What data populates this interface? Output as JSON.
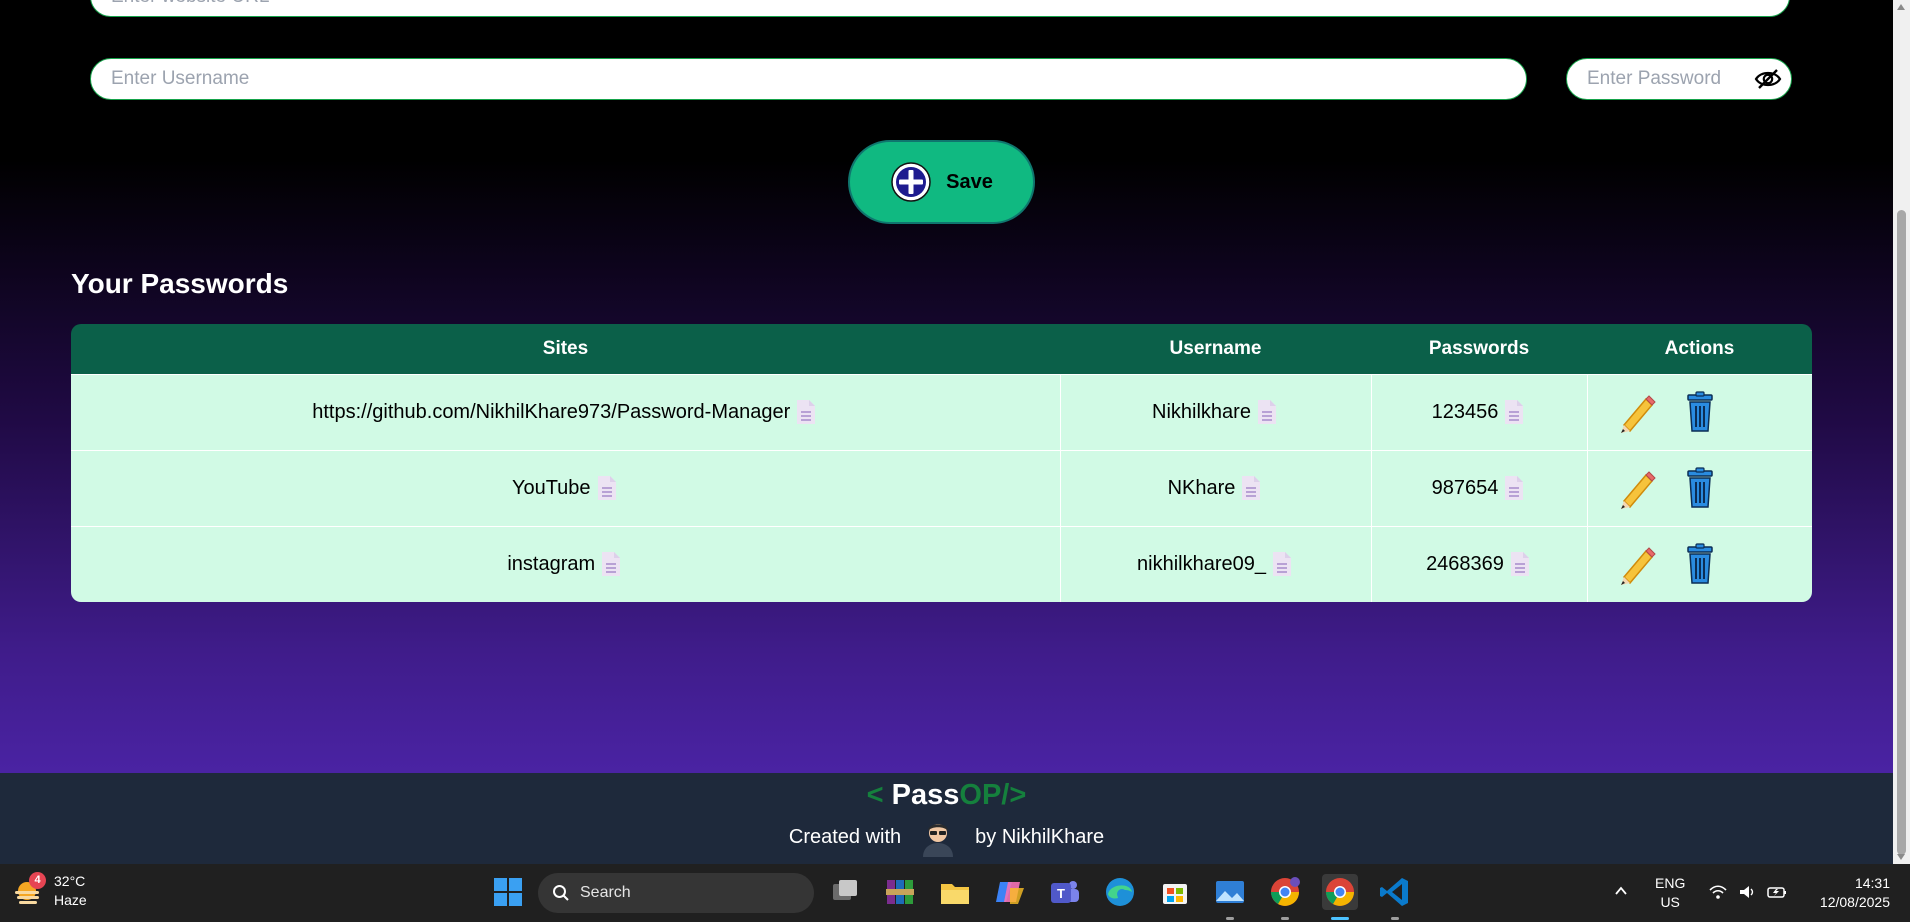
{
  "form": {
    "url_placeholder": "Enter website URL",
    "username_placeholder": "Enter Username",
    "password_placeholder": "Enter Password",
    "save_label": "Save"
  },
  "section_title": "Your Passwords",
  "table": {
    "headers": [
      "Sites",
      "Username",
      "Passwords",
      "Actions"
    ],
    "rows": [
      {
        "site": "https://github.com/NikhilKhare973/Password-Manager",
        "username": "Nikhilkhare",
        "password": "123456"
      },
      {
        "site": "YouTube",
        "username": "NKhare",
        "password": "987654"
      },
      {
        "site": "instagram",
        "username": "nikhilkhare09_",
        "password": "2468369"
      }
    ]
  },
  "footer": {
    "logo_open": "<",
    "logo_pass": "Pass",
    "logo_op": "OP/>",
    "created_with": "Created with",
    "by": "by NikhilKhare"
  },
  "taskbar": {
    "weather_badge": "4",
    "temperature": "32°C",
    "condition": "Haze",
    "search_label": "Search",
    "lang_1": "ENG",
    "lang_2": "US",
    "time": "14:31",
    "date": "12/08/2025"
  },
  "colors": {
    "accent": "#10b981",
    "table_header": "#0b6049",
    "table_row": "#d1fae5",
    "footer_bg": "#1e293b",
    "logo_green": "#15803d"
  }
}
